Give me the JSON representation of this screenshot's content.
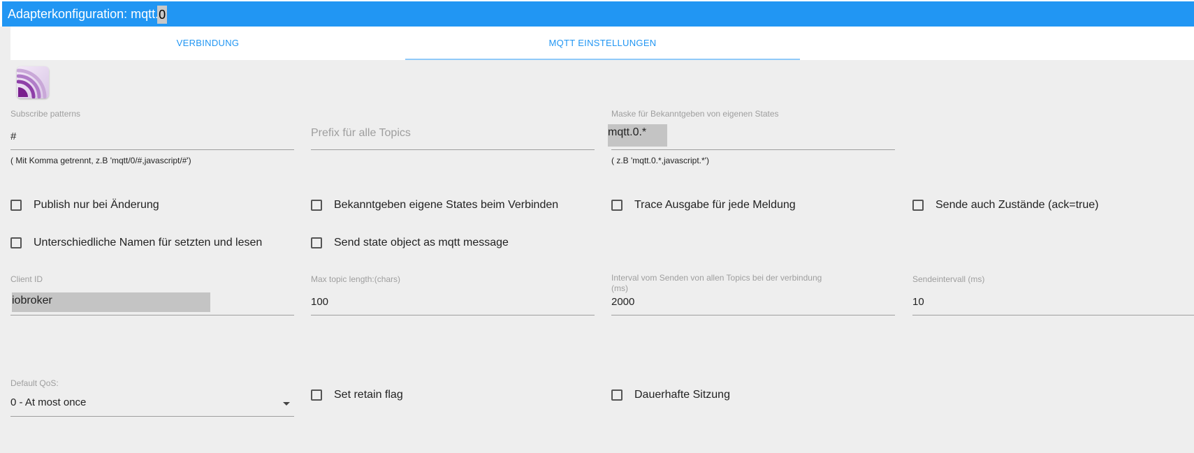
{
  "window": {
    "title": "Adapterkonfiguration: mqtt.",
    "instance": "0"
  },
  "tabs": [
    {
      "label": "VERBINDUNG",
      "active": false
    },
    {
      "label": "MQTT EINSTELLUNGEN",
      "active": true
    }
  ],
  "colors": {
    "accent": "#2196f3",
    "panel": "#eeeeee",
    "highlight": "#c4c4c4"
  },
  "logo": {
    "icon": "mqtt-logo-icon"
  },
  "subscribe": {
    "label": "Subscribe patterns",
    "value": "#",
    "help": "( Mit Komma getrennt, z.B 'mqtt/0/#,javascript/#')"
  },
  "prefix": {
    "placeholder": "Prefix für alle Topics",
    "value": ""
  },
  "mask": {
    "label": "Maske für Bekanntgeben von eigenen States",
    "value": "mqtt.0.*",
    "help": "( z.B 'mqtt.0.*,javascript.*')"
  },
  "checkboxes": {
    "publish_on_change": {
      "label": "Publish nur bei Änderung",
      "checked": false
    },
    "announce_own_states": {
      "label": "Bekanntgeben eigene States beim Verbinden",
      "checked": false
    },
    "trace_output": {
      "label": "Trace Ausgabe für jede Meldung",
      "checked": false
    },
    "send_ack_true": {
      "label": "Sende auch Zustände (ack=true)",
      "checked": false
    },
    "different_names": {
      "label": "Unterschiedliche Namen für setzten und lesen",
      "checked": false
    },
    "send_state_object": {
      "label": "Send state object as mqtt message",
      "checked": false
    },
    "retain_flag": {
      "label": "Set retain flag",
      "checked": false
    },
    "persistent_session": {
      "label": "Dauerhafte Sitzung",
      "checked": false
    }
  },
  "client_id": {
    "label": "Client ID",
    "value": "iobroker"
  },
  "max_topic_length": {
    "label": "Max topic length:(chars)",
    "value": "100"
  },
  "send_interval_all": {
    "label_line1": "Interval vom Senden von allen Topics bei der verbindung",
    "label_line2": "(ms)",
    "value": "2000"
  },
  "send_interval": {
    "label": "Sendeintervall (ms)",
    "value": "10"
  },
  "default_qos": {
    "label": "Default QoS:",
    "value": "0 - At most once"
  }
}
